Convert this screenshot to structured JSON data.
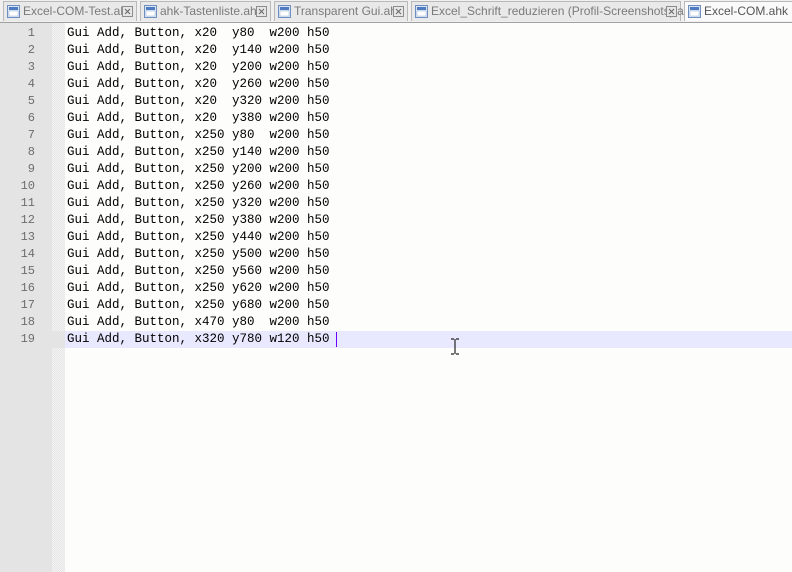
{
  "tabs": [
    {
      "label": "Excel-COM-Test.ahk",
      "active": false
    },
    {
      "label": "ahk-Tastenliste.ahk",
      "active": false
    },
    {
      "label": "Transparent Gui.ahk",
      "active": false
    },
    {
      "label": "Excel_Schrift_reduzieren (Profil-Screenshots).ahk",
      "active": false
    },
    {
      "label": "Excel-COM.ahk",
      "active": true
    }
  ],
  "editor": {
    "current_line": 19,
    "lines": [
      {
        "number": "1",
        "text": "Gui Add, Button, x20  y80  w200 h50"
      },
      {
        "number": "2",
        "text": "Gui Add, Button, x20  y140 w200 h50"
      },
      {
        "number": "3",
        "text": "Gui Add, Button, x20  y200 w200 h50"
      },
      {
        "number": "4",
        "text": "Gui Add, Button, x20  y260 w200 h50"
      },
      {
        "number": "5",
        "text": "Gui Add, Button, x20  y320 w200 h50"
      },
      {
        "number": "6",
        "text": "Gui Add, Button, x20  y380 w200 h50"
      },
      {
        "number": "7",
        "text": "Gui Add, Button, x250 y80  w200 h50"
      },
      {
        "number": "8",
        "text": "Gui Add, Button, x250 y140 w200 h50"
      },
      {
        "number": "9",
        "text": "Gui Add, Button, x250 y200 w200 h50"
      },
      {
        "number": "10",
        "text": "Gui Add, Button, x250 y260 w200 h50"
      },
      {
        "number": "11",
        "text": "Gui Add, Button, x250 y320 w200 h50"
      },
      {
        "number": "12",
        "text": "Gui Add, Button, x250 y380 w200 h50"
      },
      {
        "number": "13",
        "text": "Gui Add, Button, x250 y440 w200 h50"
      },
      {
        "number": "14",
        "text": "Gui Add, Button, x250 y500 w200 h50"
      },
      {
        "number": "15",
        "text": "Gui Add, Button, x250 y560 w200 h50"
      },
      {
        "number": "16",
        "text": "Gui Add, Button, x250 y620 w200 h50"
      },
      {
        "number": "17",
        "text": "Gui Add, Button, x250 y680 w200 h50"
      },
      {
        "number": "18",
        "text": "Gui Add, Button, x470 y80  w200 h50"
      },
      {
        "number": "19",
        "text": "Gui Add, Button, x320 y780 w120 h50"
      }
    ]
  },
  "colors": {
    "current_line_highlight": "#e8e8ff",
    "caret": "#6b00ff",
    "gutter": "#e4e4e4"
  }
}
